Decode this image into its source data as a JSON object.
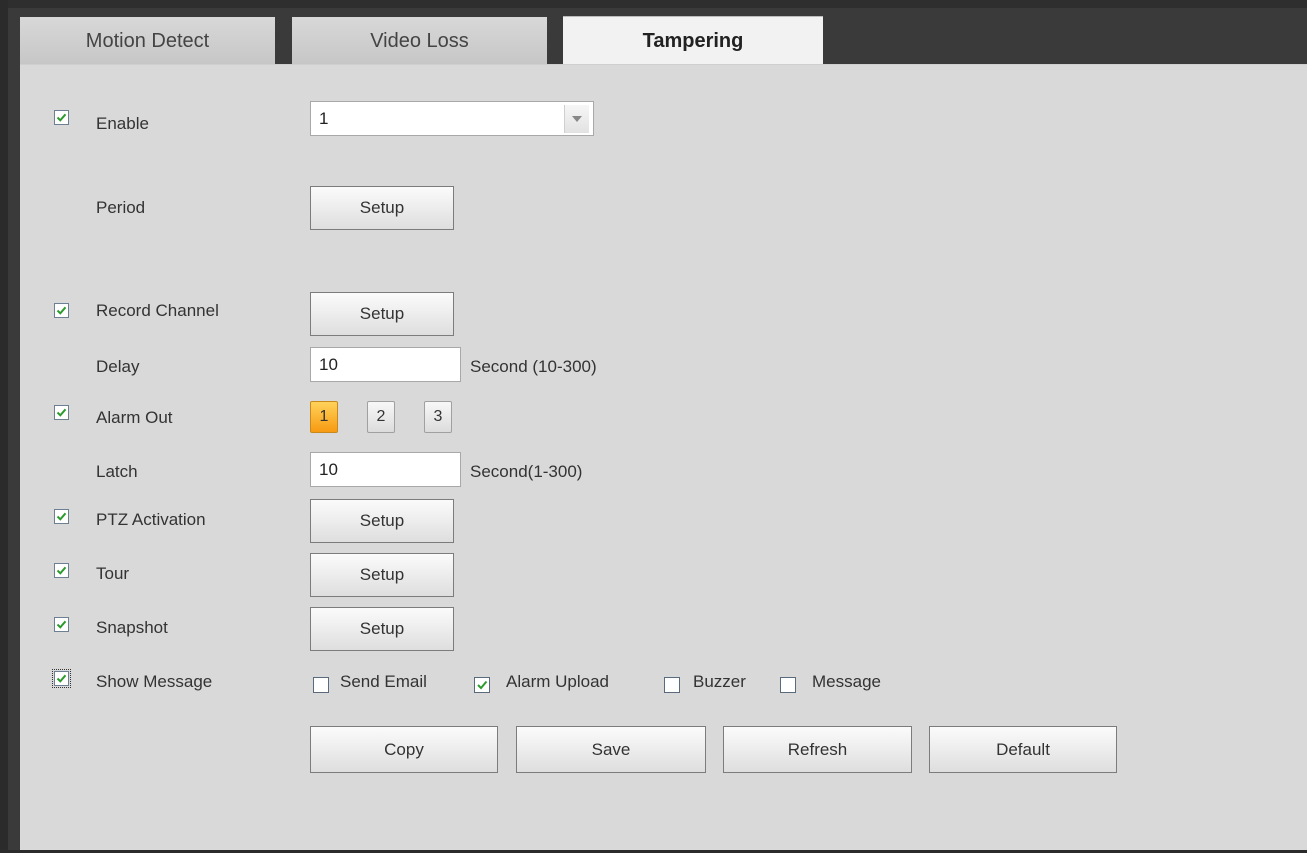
{
  "tabs": [
    {
      "label": "Motion Detect"
    },
    {
      "label": "Video Loss"
    },
    {
      "label": "Tampering"
    }
  ],
  "form": {
    "enable": {
      "label": "Enable",
      "checked": true,
      "channel": "1"
    },
    "period": {
      "label": "Period",
      "button": "Setup"
    },
    "record_channel": {
      "label": "Record Channel",
      "checked": true,
      "button": "Setup"
    },
    "delay": {
      "label": "Delay",
      "value": "10",
      "unit": "Second (10-300)"
    },
    "alarm_out": {
      "label": "Alarm Out",
      "checked": true,
      "outputs": [
        "1",
        "2",
        "3"
      ],
      "selected": "1"
    },
    "latch": {
      "label": "Latch",
      "value": "10",
      "unit": "Second(1-300)"
    },
    "ptz_activation": {
      "label": "PTZ Activation",
      "checked": true,
      "button": "Setup"
    },
    "tour": {
      "label": "Tour",
      "checked": true,
      "button": "Setup"
    },
    "snapshot": {
      "label": "Snapshot",
      "checked": true,
      "button": "Setup"
    },
    "show_message": {
      "label": "Show Message",
      "checked": true,
      "options": [
        {
          "label": "Send Email",
          "checked": false
        },
        {
          "label": "Alarm Upload",
          "checked": true
        },
        {
          "label": "Buzzer",
          "checked": false
        },
        {
          "label": "Message",
          "checked": false
        }
      ]
    }
  },
  "actions": {
    "copy": "Copy",
    "save": "Save",
    "refresh": "Refresh",
    "default": "Default"
  },
  "colors": {
    "check": "#2d9a2d",
    "selected_output": "#f7a21b"
  }
}
